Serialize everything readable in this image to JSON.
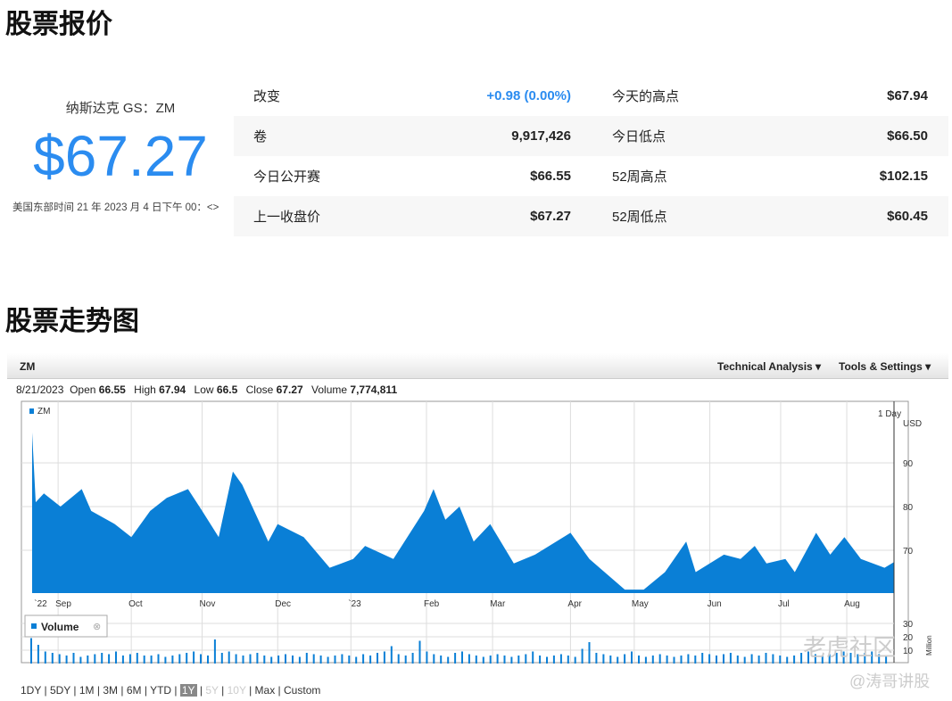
{
  "title": "股票报价",
  "quote": {
    "exchange": "纳斯达克 GS：ZM",
    "price": "$67.27",
    "timestamp": "美国东部时间 21 年 2023 月 4 日下午 00：<>"
  },
  "stats": [
    {
      "l1": "改变",
      "v1": "+0.98 (0.00%)",
      "l2": "今天的高点",
      "v2": "$67.94"
    },
    {
      "l1": "卷",
      "v1": "9,917,426",
      "l2": "今日低点",
      "v2": "$66.50"
    },
    {
      "l1": "今日公开赛",
      "v1": "$66.55",
      "l2": "52周高点",
      "v2": "$102.15"
    },
    {
      "l1": "上一收盘价",
      "v1": "$67.27",
      "l2": "52周低点",
      "v2": "$60.45"
    }
  ],
  "chart_title": "股票走势图",
  "toolbar": {
    "symbol": "ZM",
    "tech": "Technical Analysis ▾",
    "tools": "Tools & Settings ▾"
  },
  "ohlc": {
    "date": "8/21/2023",
    "open_l": "Open",
    "open": "66.55",
    "high_l": "High",
    "high": "67.94",
    "low_l": "Low",
    "low": "66.5",
    "close_l": "Close",
    "close": "67.27",
    "vol_l": "Volume",
    "vol": "7,774,811"
  },
  "colors": {
    "accent": "#2b8cf0",
    "area": "#0a7fd6"
  },
  "chart_data": {
    "type": "area",
    "legend": "ZM",
    "interval": "1 Day",
    "currency": "USD",
    "yticks": [
      70,
      80,
      90
    ],
    "ylim": [
      60.2,
      99
    ],
    "xticks": [
      {
        "l": "`22",
        "d": 2
      },
      {
        "l": "Sep",
        "d": 11
      },
      {
        "l": "Oct",
        "d": 42
      },
      {
        "l": "Nov",
        "d": 72
      },
      {
        "l": "Dec",
        "d": 104
      },
      {
        "l": "`23",
        "d": 135
      },
      {
        "l": "Feb",
        "d": 167
      },
      {
        "l": "Mar",
        "d": 195
      },
      {
        "l": "Apr",
        "d": 228
      },
      {
        "l": "May",
        "d": 255
      },
      {
        "l": "Jun",
        "d": 287
      },
      {
        "l": "Jul",
        "d": 317
      },
      {
        "l": "Aug",
        "d": 345
      }
    ],
    "series": [
      [
        0,
        97
      ],
      [
        1.5,
        81
      ],
      [
        5,
        83
      ],
      [
        12,
        80
      ],
      [
        21,
        84
      ],
      [
        25,
        79
      ],
      [
        35,
        76
      ],
      [
        42,
        73
      ],
      [
        50,
        79
      ],
      [
        57,
        82
      ],
      [
        66,
        84
      ],
      [
        72,
        79
      ],
      [
        79,
        73
      ],
      [
        85,
        88
      ],
      [
        89,
        85
      ],
      [
        100,
        72
      ],
      [
        104,
        76
      ],
      [
        115,
        73
      ],
      [
        126,
        66
      ],
      [
        136,
        68
      ],
      [
        141,
        71
      ],
      [
        153,
        68
      ],
      [
        166,
        79
      ],
      [
        170,
        84
      ],
      [
        175,
        77
      ],
      [
        181,
        80
      ],
      [
        187,
        72
      ],
      [
        194,
        76
      ],
      [
        204,
        67
      ],
      [
        213,
        69
      ],
      [
        228,
        74
      ],
      [
        236,
        68
      ],
      [
        251,
        61
      ],
      [
        259,
        61
      ],
      [
        268,
        65
      ],
      [
        277,
        72
      ],
      [
        281,
        65
      ],
      [
        293,
        69
      ],
      [
        300,
        68
      ],
      [
        306,
        71
      ],
      [
        311,
        67
      ],
      [
        319,
        68
      ],
      [
        323,
        65
      ],
      [
        332,
        74
      ],
      [
        338,
        69
      ],
      [
        344,
        73
      ],
      [
        351,
        68
      ],
      [
        361,
        66
      ],
      [
        365,
        67.3
      ]
    ],
    "volume": {
      "label": "Volume",
      "unit": "Million",
      "yticks": [
        10,
        20,
        30
      ],
      "values": [
        19,
        14,
        9,
        8,
        7,
        6,
        8,
        5,
        6,
        7,
        8,
        7,
        9,
        6,
        7,
        8,
        6,
        6,
        7,
        5,
        6,
        7,
        8,
        9,
        7,
        6,
        18,
        8,
        9,
        7,
        6,
        7,
        8,
        6,
        5,
        6,
        7,
        6,
        5,
        8,
        7,
        6,
        5,
        6,
        7,
        6,
        5,
        7,
        6,
        8,
        9,
        13,
        7,
        6,
        8,
        17,
        9,
        7,
        6,
        5,
        8,
        9,
        7,
        6,
        5,
        6,
        7,
        6,
        5,
        6,
        7,
        9,
        6,
        5,
        6,
        7,
        6,
        5,
        11,
        16,
        8,
        7,
        6,
        5,
        7,
        9,
        6,
        5,
        6,
        7,
        6,
        5,
        6,
        7,
        6,
        8,
        7,
        6,
        7,
        8,
        6,
        5,
        7,
        6,
        8,
        7,
        6,
        5,
        6,
        8,
        9,
        7,
        6,
        7,
        8,
        9,
        8,
        7,
        8,
        9,
        7,
        6
      ]
    }
  },
  "range": [
    "1DY",
    "5DY",
    "1M",
    "3M",
    "6M",
    "YTD",
    "1Y",
    "5Y",
    "10Y",
    "Max",
    "Custom"
  ],
  "range_selected": "1Y",
  "watermark": [
    "老虎社区",
    "@涛哥讲股"
  ]
}
